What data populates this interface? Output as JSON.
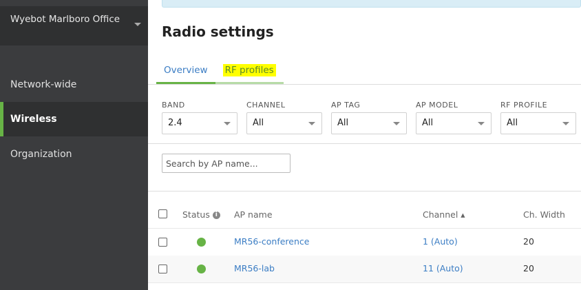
{
  "sidebar": {
    "org_name": "Wyebot Marlboro Office",
    "items": [
      {
        "label": "Network-wide"
      },
      {
        "label": "Wireless"
      },
      {
        "label": "Organization"
      }
    ]
  },
  "page": {
    "title": "Radio settings",
    "tabs": [
      {
        "label": "Overview"
      },
      {
        "label": "RF profiles"
      }
    ]
  },
  "filters": [
    {
      "label": "BAND",
      "value": "2.4"
    },
    {
      "label": "CHANNEL",
      "value": "All"
    },
    {
      "label": "AP TAG",
      "value": "All"
    },
    {
      "label": "AP MODEL",
      "value": "All"
    },
    {
      "label": "RF PROFILE",
      "value": "All"
    }
  ],
  "search": {
    "placeholder": "Search by AP name..."
  },
  "table": {
    "columns": [
      "Status",
      "AP name",
      "Channel ▴",
      "Ch. Width"
    ],
    "rows": [
      {
        "status": "online",
        "ap_name": "MR56-conference",
        "channel": "1 (Auto)",
        "width": "20"
      },
      {
        "status": "online",
        "ap_name": "MR56-lab",
        "channel": "11 (Auto)",
        "width": "20"
      }
    ]
  },
  "colors": {
    "accent": "#67b346",
    "link": "#3b7dc4",
    "highlight": "#ffff00"
  }
}
